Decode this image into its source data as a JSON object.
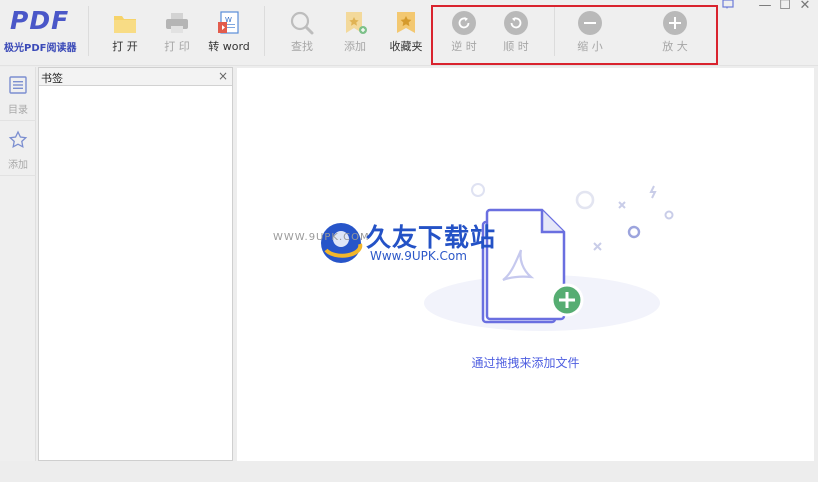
{
  "app": {
    "logo_mark": "PDF",
    "logo_text": "极光PDF阅读器"
  },
  "toolbar": {
    "open": "打 开",
    "print": "打 印",
    "to_word": "转 word",
    "find": "查找",
    "add": "添加",
    "favorites": "收藏夹",
    "rotate_ccw": "逆 时",
    "rotate_cw": "顺 时",
    "zoom_out": "缩 小",
    "zoom_in": "放 大"
  },
  "window": {
    "minimize": "—",
    "maximize": "☐",
    "close": "✕"
  },
  "rail": {
    "toc": "目录",
    "add": "添加"
  },
  "bookmark_panel": {
    "title": "书签",
    "close": "×"
  },
  "main": {
    "drop_hint": "通过拖拽来添加文件"
  },
  "watermark": {
    "title": "久友下载站",
    "url_left": "WWW.9UPK.COM",
    "url": "Www.9UPK.Com"
  },
  "colors": {
    "accent": "#4e5ee0",
    "logo": "#4a57c8",
    "highlight": "#d9232e",
    "folder": "#f6c94e",
    "icon_disabled": "#b9b9b9"
  }
}
